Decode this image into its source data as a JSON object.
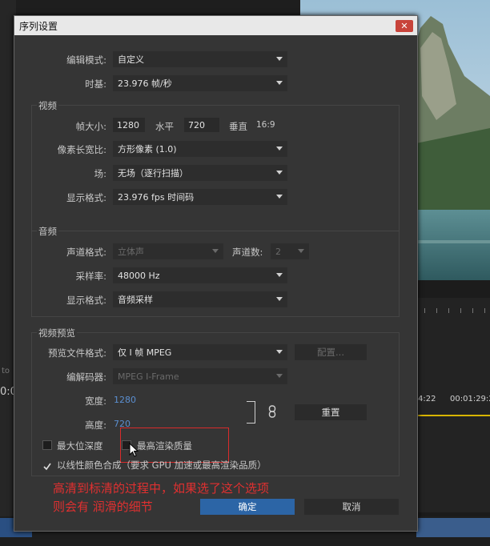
{
  "dialog": {
    "title": "序列设置",
    "close": "✕"
  },
  "general": {
    "edit_mode_label": "编辑模式:",
    "edit_mode_value": "自定义",
    "timebase_label": "时基:",
    "timebase_value": "23.976 帧/秒"
  },
  "video": {
    "legend": "视频",
    "frame_size_label": "帧大小:",
    "width": "1280",
    "horizontal_label": "水平",
    "height": "720",
    "vertical_label": "垂直",
    "aspect": "16:9",
    "pixel_aspect_label": "像素长宽比:",
    "pixel_aspect_value": "方形像素 (1.0)",
    "fields_label": "场:",
    "fields_value": "无场（逐行扫描）",
    "display_format_label": "显示格式:",
    "display_format_value": "23.976 fps 时间码"
  },
  "audio": {
    "legend": "音频",
    "channel_format_label": "声道格式:",
    "channel_format_value": "立体声",
    "channels_label": "声道数:",
    "channels_value": "2",
    "sample_rate_label": "采样率:",
    "sample_rate_value": "48000 Hz",
    "display_format_label": "显示格式:",
    "display_format_value": "音频采样"
  },
  "preview": {
    "legend": "视频预览",
    "file_format_label": "预览文件格式:",
    "file_format_value": "仅 I 帧 MPEG",
    "config_button": "配置...",
    "codec_label": "编解码器:",
    "codec_value": "MPEG I-Frame",
    "width_label": "宽度:",
    "width_value": "1280",
    "height_label": "高度:",
    "height_value": "720",
    "reset_button": "重置",
    "max_bit_depth": "最大位深度",
    "max_render_quality": "最高渲染质量",
    "linear_color": "以线性颜色合成（要求 GPU 加速或最高渲染品质）"
  },
  "annotation": {
    "line1": "高清到标清的过程中，如果选了这个选项",
    "line2": "则会有 润滑的细节"
  },
  "buttons": {
    "ok": "确定",
    "cancel": "取消"
  },
  "background": {
    "tc1": "4:22",
    "tc2": "00:01:29:2",
    "left1": "to",
    "left2": "0:0"
  },
  "colors": {
    "accent": "#2c65a6",
    "annotation": "#e03030",
    "highlight_box": "#d92b2b"
  }
}
